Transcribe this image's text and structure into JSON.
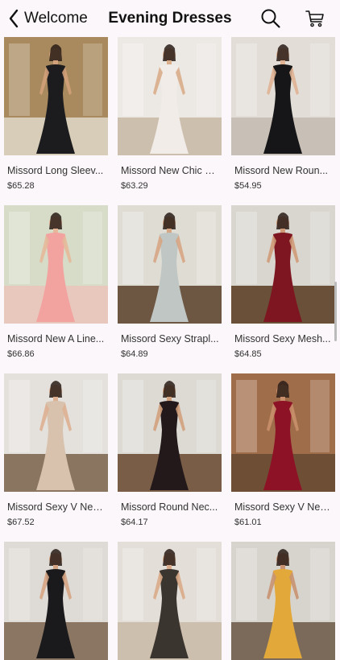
{
  "nav": {
    "back_label": "Welcome",
    "title": "Evening Dresses",
    "search_icon": "search-icon",
    "cart_icon": "cart-icon"
  },
  "products": [
    {
      "name": "Missord Long Sleev...",
      "price": "$65.28",
      "bg": "#a88a5e",
      "floor": "#d8cdb8",
      "dress": "#1c1c1e",
      "skin": "#d2a07a"
    },
    {
      "name": "Missord New Chic E...",
      "price": "$63.29",
      "bg": "#ece8e4",
      "floor": "#cdbfae",
      "dress": "#f1ece8",
      "skin": "#d9ad8a"
    },
    {
      "name": "Missord New Roun...",
      "price": "$54.95",
      "bg": "#e2ddd6",
      "floor": "#c8c0b6",
      "dress": "#161618",
      "skin": "#e0b394"
    },
    {
      "name": "Missord New A Line...",
      "price": "$66.86",
      "bg": "#d7dcc8",
      "floor": "#e8c8bc",
      "dress": "#f2a3a0",
      "skin": "#e6b899"
    },
    {
      "name": "Missord Sexy Strapl...",
      "price": "$64.89",
      "bg": "#dfdcd4",
      "floor": "#6d5642",
      "dress": "#bfc6c3",
      "skin": "#d6a583"
    },
    {
      "name": "Missord Sexy Mesh...",
      "price": "$64.85",
      "bg": "#d9d6cf",
      "floor": "#6a5038",
      "dress": "#7d1620",
      "skin": "#cf9a77"
    },
    {
      "name": "Missord Sexy V Nec...",
      "price": "$67.52",
      "bg": "#e4e1dc",
      "floor": "#8a7660",
      "dress": "#d8c2ad",
      "skin": "#deb092"
    },
    {
      "name": "Missord Round Nec...",
      "price": "$64.17",
      "bg": "#dddad4",
      "floor": "#7a5d46",
      "dress": "#23191a",
      "skin": "#d1a07c"
    },
    {
      "name": "Missord Sexy V Nec...",
      "price": "$61.01",
      "bg": "#a06d4a",
      "floor": "#6f4e36",
      "dress": "#8e1226",
      "skin": "#c98f6c"
    }
  ],
  "partial_products": [
    {
      "bg": "#dedad5",
      "floor": "#8a7662",
      "dress": "#1a1a1c",
      "skin": "#d5a482"
    },
    {
      "bg": "#e3ded7",
      "floor": "#cdbfae",
      "dress": "#3b352f",
      "skin": "#d9ab8a"
    },
    {
      "bg": "#d7d3cd",
      "floor": "#7b6a5a",
      "dress": "#e2a83a",
      "skin": "#c99270"
    }
  ]
}
